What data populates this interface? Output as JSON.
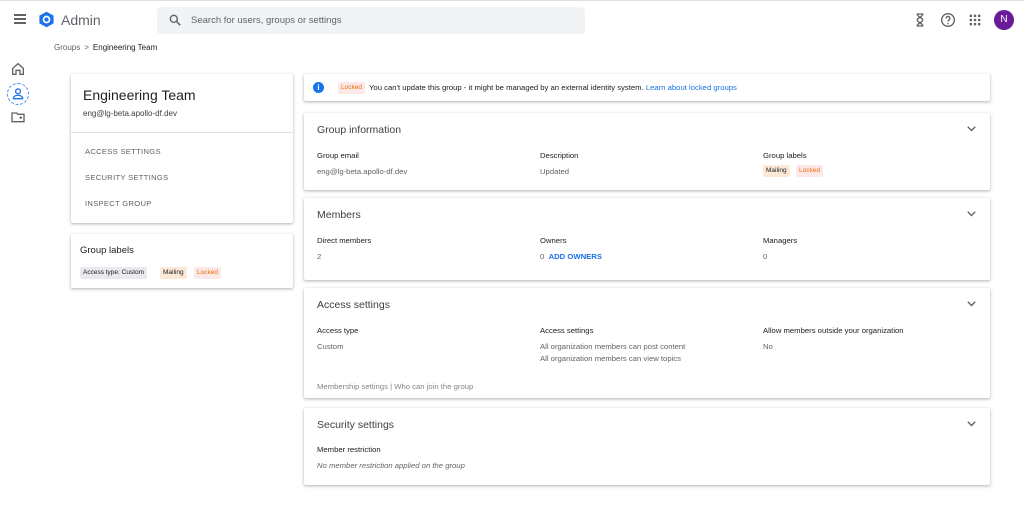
{
  "header": {
    "app_title": "Admin",
    "search_placeholder": "Search for users, groups or settings",
    "avatar_initial": "N"
  },
  "breadcrumb": {
    "parent": "Groups",
    "separator": ">",
    "current": "Engineering Team"
  },
  "group": {
    "name": "Engineering Team",
    "email": "eng@lg-beta.apollo-df.dev",
    "nav_links": [
      "ACCESS SETTINGS",
      "SECURITY SETTINGS",
      "INSPECT GROUP"
    ]
  },
  "labels_card": {
    "title": "Group labels",
    "chips": [
      "Access type: Custom",
      "Mailing",
      "Locked"
    ]
  },
  "banner": {
    "badge": "Locked",
    "message": "You can't update this group - it might be managed by an external identity system.",
    "link": "Learn about locked groups"
  },
  "group_info": {
    "title": "Group information",
    "email_label": "Group email",
    "email_value": "eng@lg-beta.apollo-df.dev",
    "description_label": "Description",
    "description_value": "Updated",
    "labels_label": "Group labels",
    "labels": [
      "Mailing",
      "Locked"
    ]
  },
  "members": {
    "title": "Members",
    "direct_label": "Direct members",
    "direct_value": "2",
    "owners_label": "Owners",
    "owners_value": "0",
    "add_owners": "ADD OWNERS",
    "managers_label": "Managers",
    "managers_value": "0"
  },
  "access": {
    "title": "Access settings",
    "type_label": "Access type",
    "type_value": "Custom",
    "settings_label": "Access settings",
    "settings_line1": "All organization members can post content",
    "settings_line2": "All organization members can view topics",
    "outside_label": "Allow members outside your organization",
    "outside_value": "No",
    "footer_link1": "Membership settings",
    "footer_sep": "|",
    "footer_link2": "Who can join the group"
  },
  "security": {
    "title": "Security settings",
    "restriction_label": "Member restriction",
    "restriction_value": "No member restriction applied on the group"
  },
  "colors": {
    "accent": "#1a73e8",
    "avatar": "#6a1b9a",
    "locked_text": "#e8710a"
  },
  "icons": [
    "menu-icon",
    "admin-logo-icon",
    "search-icon",
    "hourglass-icon",
    "help-icon",
    "apps-grid-icon",
    "home-icon",
    "user-icon",
    "folder-icon",
    "info-icon",
    "chevron-down-icon"
  ]
}
